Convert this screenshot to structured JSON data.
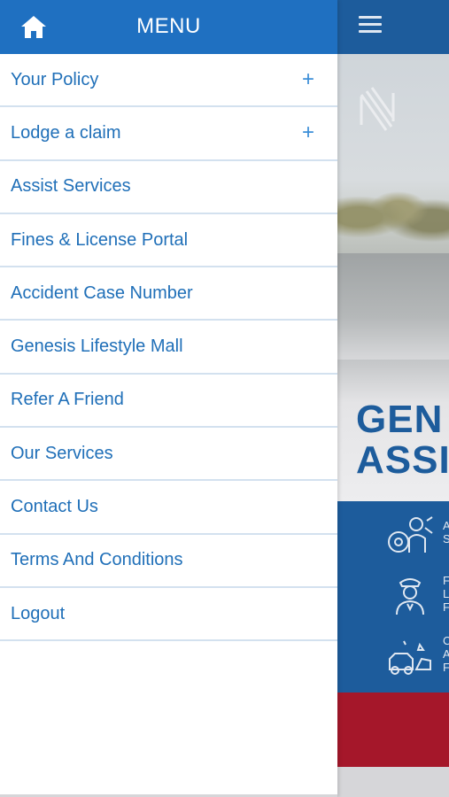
{
  "drawer": {
    "title": "MENU",
    "home_icon": "home-icon",
    "items": [
      {
        "label": "Your Policy",
        "expandable": true,
        "expand_symbol": "+"
      },
      {
        "label": "Lodge a claim",
        "expandable": true,
        "expand_symbol": "+"
      },
      {
        "label": "Assist Services",
        "expandable": false
      },
      {
        "label": "Fines & License Portal",
        "expandable": false
      },
      {
        "label": "Accident Case Number",
        "expandable": false
      },
      {
        "label": "Genesis Lifestyle Mall",
        "expandable": false
      },
      {
        "label": "Refer A Friend",
        "expandable": false
      },
      {
        "label": "Our Services",
        "expandable": false
      },
      {
        "label": "Contact Us",
        "expandable": false
      },
      {
        "label": "Terms And Conditions",
        "expandable": false
      },
      {
        "label": "Logout",
        "expandable": false
      }
    ]
  },
  "background": {
    "menu_icon": "hamburger-icon",
    "hero_title_line1": "GEN",
    "hero_title_line2": "ASSI",
    "services": [
      {
        "icon": "mechanic-icon",
        "text_line1": "A",
        "text_line2": "S",
        "text_line3": ""
      },
      {
        "icon": "officer-icon",
        "text_line1": "F",
        "text_line2": "L",
        "text_line3": "F"
      },
      {
        "icon": "accident-car-icon",
        "text_line1": "C",
        "text_line2": "A",
        "text_line3": "F"
      }
    ]
  },
  "colors": {
    "drawer_header": "#1f70c1",
    "menu_text": "#1f6fb8",
    "divider": "#d3e1ef",
    "app_blue": "#1d5c9c",
    "app_red": "#a5172a"
  }
}
